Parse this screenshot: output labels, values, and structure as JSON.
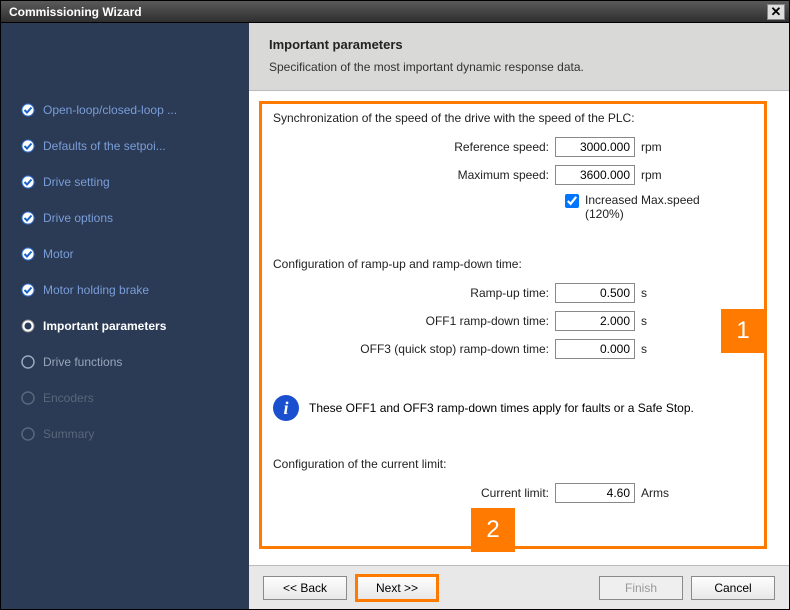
{
  "window": {
    "title": "Commissioning Wizard"
  },
  "header": {
    "title": "Important parameters",
    "subtitle": "Specification of the most important dynamic response data."
  },
  "sidebar": {
    "items": [
      {
        "label": "Open-loop/closed-loop ...",
        "state": "completed"
      },
      {
        "label": "Defaults of the setpoi...",
        "state": "completed"
      },
      {
        "label": "Drive setting",
        "state": "completed"
      },
      {
        "label": "Drive options",
        "state": "completed"
      },
      {
        "label": "Motor",
        "state": "completed"
      },
      {
        "label": "Motor holding brake",
        "state": "completed"
      },
      {
        "label": "Important parameters",
        "state": "current"
      },
      {
        "label": "Drive functions",
        "state": "pending"
      },
      {
        "label": "Encoders",
        "state": "disabled"
      },
      {
        "label": "Summary",
        "state": "disabled"
      }
    ]
  },
  "sections": {
    "sync": {
      "title": "Synchronization of the speed of the drive with the speed of the PLC:",
      "reference_speed": {
        "label": "Reference speed:",
        "value": "3000.000",
        "unit": "rpm"
      },
      "maximum_speed": {
        "label": "Maximum speed:",
        "value": "3600.000",
        "unit": "rpm"
      },
      "increased": {
        "label": "Increased Max.speed (120%)",
        "checked": true
      }
    },
    "ramp": {
      "title": "Configuration of ramp-up and ramp-down time:",
      "ramp_up": {
        "label": "Ramp-up time:",
        "value": "0.500",
        "unit": "s"
      },
      "off1": {
        "label": "OFF1 ramp-down time:",
        "value": "2.000",
        "unit": "s"
      },
      "off3": {
        "label": "OFF3 (quick stop) ramp-down time:",
        "value": "0.000",
        "unit": "s"
      },
      "info": "These OFF1 and OFF3 ramp-down times apply for faults or a Safe Stop."
    },
    "current": {
      "title": "Configuration of the current limit:",
      "limit": {
        "label": "Current limit:",
        "value": "4.60",
        "unit": "Arms"
      }
    }
  },
  "footer": {
    "back": "<< Back",
    "next": "Next >>",
    "finish": "Finish",
    "cancel": "Cancel"
  },
  "callouts": {
    "one": "1",
    "two": "2"
  }
}
